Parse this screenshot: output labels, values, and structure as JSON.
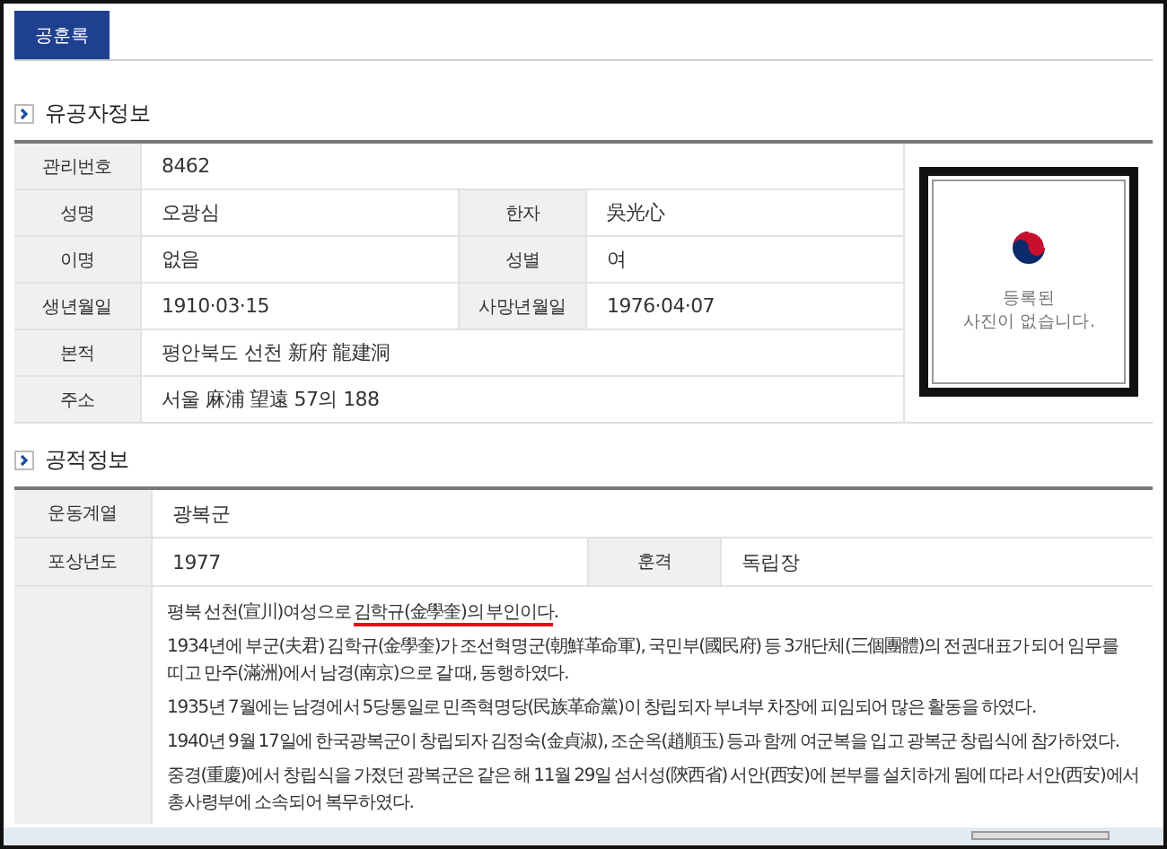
{
  "tabs": [
    {
      "label": "공훈록",
      "selected": true
    }
  ],
  "sections": [
    {
      "title": "유공자정보",
      "rows": [
        {
          "cells": [
            {
              "label": "관리번호",
              "value": "8462"
            }
          ]
        },
        {
          "cells": [
            {
              "label": "성명",
              "value": "오광심"
            },
            {
              "label": "한자",
              "value": "吳光心"
            }
          ]
        },
        {
          "cells": [
            {
              "label": "이명",
              "value": "없음"
            },
            {
              "label": "성별",
              "value": "여"
            }
          ]
        },
        {
          "cells": [
            {
              "label": "생년월일",
              "value": "1910·03·15"
            },
            {
              "label": "사망년월일",
              "value": "1976·04·07"
            }
          ]
        },
        {
          "cells": [
            {
              "label": "본적",
              "value": "평안북도 선천 新府 龍建洞"
            }
          ]
        },
        {
          "cells": [
            {
              "label": "주소",
              "value": "서울 麻浦 望遠 57의 188"
            }
          ]
        }
      ],
      "photo": {
        "caption_lines": [
          "등록된",
          "사진이 없습니다."
        ]
      }
    },
    {
      "title": "공적정보",
      "rows": [
        {
          "cells": [
            {
              "label": "운동계열",
              "value": "광복군"
            }
          ]
        },
        {
          "cells": [
            {
              "label": "포상년도",
              "value": "1977"
            },
            {
              "label": "훈격",
              "value": "독립장"
            }
          ]
        }
      ],
      "description": [
        [
          {
            "text": "평북 선천(宣川)여성으로 ",
            "underline": false
          },
          {
            "text": "김학규(金學奎)의 부인이다",
            "underline": true
          },
          {
            "text": ".",
            "underline": false
          }
        ],
        [
          {
            "text": "1934년에 부군(夫君) 김학규(金學奎)가 조선혁명군(朝鮮革命軍), 국민부(國民府) 등 3개단체(三個團體)의 전권대표가 되어 임무를 띠고 만주(滿洲)에서 남경(南京)으로 갈 때, 동행하였다.",
            "underline": false
          }
        ],
        [
          {
            "text": "1935년 7월에는 남경에서 5당통일로 민족혁명당(民族革命黨)이 창립되자 부녀부 차장에 피임되어 많은 활동을 하였다.",
            "underline": false
          }
        ],
        [
          {
            "text": "1940년 9월 17일에 한국광복군이 창립되자 김정숙(金貞淑), 조순옥(趙順玉) 등과 함께 여군복을 입고 광복군 창립식에 참가하였다.",
            "underline": false
          }
        ],
        [
          {
            "text": "중경(重慶)에서 창립식을 가졌던 광복군은 같은 해 11월 29일 섬서성(陝西省) 서안(西安)에 본부를 설치하게 됨에 따라 서안(西安)에서 총사령부에 소속되어 복무하였다.",
            "underline": false
          }
        ]
      ]
    }
  ]
}
